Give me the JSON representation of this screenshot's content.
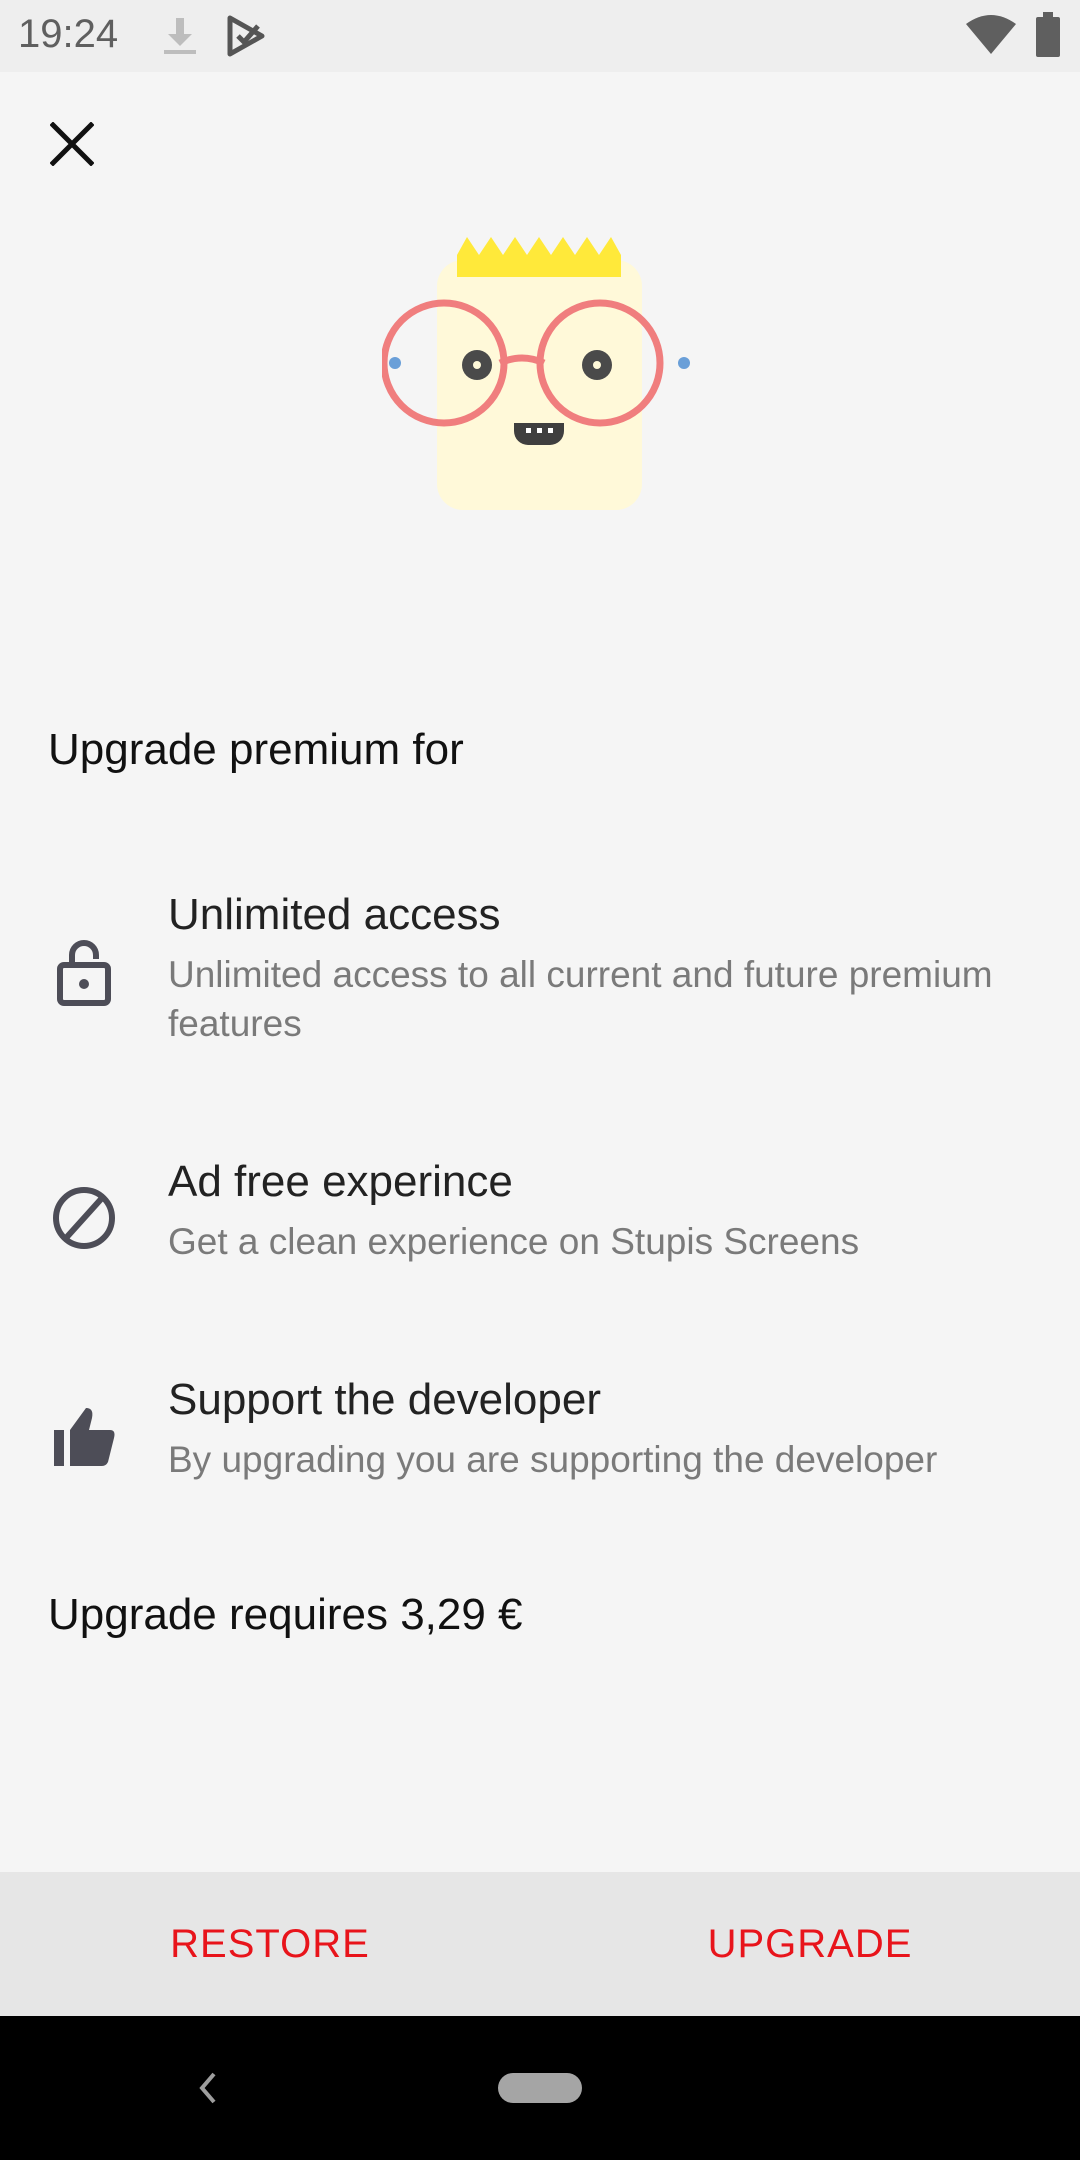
{
  "status_bar": {
    "time": "19:24",
    "icons": [
      "download-icon",
      "play-store-check-icon",
      "wifi-icon",
      "battery-icon"
    ]
  },
  "header": {
    "close_icon": "close-icon"
  },
  "content": {
    "section_title": "Upgrade premium for",
    "features": [
      {
        "icon": "lock-open-icon",
        "title": "Unlimited access",
        "description": "Unlimited access to all current and future premium features"
      },
      {
        "icon": "block-icon",
        "title": "Ad free experince",
        "description": "Get a clean experience on Stupis Screens"
      },
      {
        "icon": "thumbs-up-icon",
        "title": "Support the developer",
        "description": "By upgrading you are supporting the developer"
      }
    ],
    "price_text": "Upgrade requires 3,29 €"
  },
  "actions": {
    "restore_label": "RESTORE",
    "upgrade_label": "UPGRADE",
    "accent_color": "#e8141b"
  },
  "nav_bar": {
    "back_icon": "back-icon",
    "home_icon": "home-pill-icon"
  }
}
